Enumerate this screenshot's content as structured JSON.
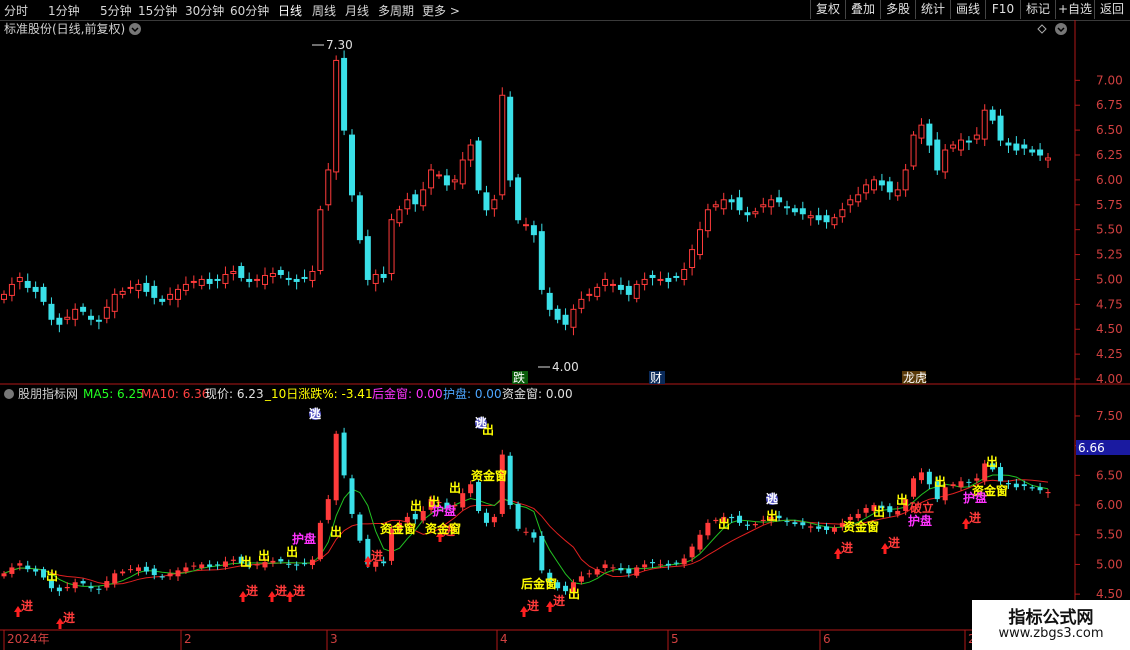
{
  "toolbar": {
    "timeframes": [
      "分时",
      "1分钟",
      "5分钟",
      "15分钟",
      "30分钟",
      "60分钟",
      "日线",
      "周线",
      "月线",
      "多周期",
      "更多 >"
    ],
    "active_timeframe": "日线",
    "right_buttons": [
      "复权",
      "叠加",
      "多股",
      "统计",
      "画线",
      "F10",
      "标记",
      "+自选",
      "返回"
    ]
  },
  "main_panel": {
    "title": "标准股份(日线,前复权)",
    "y_ticks": [
      "7.00",
      "6.75",
      "6.50",
      "6.25",
      "6.00",
      "5.75",
      "5.50",
      "5.25",
      "5.00",
      "4.75",
      "4.50",
      "4.25",
      "4.00"
    ],
    "high_label": "7.30",
    "low_label": "4.00",
    "event_labels": [
      "跌",
      "财",
      "龙虎"
    ]
  },
  "sub_panel": {
    "title": "股朋指标网",
    "ma5": "MA5: 6.25",
    "ma10": "MA10: 6.36",
    "price": "现价: 6.23",
    "chg": "_10日涨跌%: -3.41",
    "hou": "后金窗: 0.00",
    "hu": "护盘: 0.00",
    "zi": "资金窗: 0.00",
    "y_ticks": [
      "7.50",
      "7.00",
      "6.50",
      "6.00",
      "5.50",
      "5.00",
      "4.50"
    ],
    "current_value": "6.66"
  },
  "signals": {
    "out": "出",
    "in": "进",
    "escape": "逃",
    "capital_window": "资金窗",
    "later_window": "后金窗",
    "protect": "护盘",
    "break": "破立"
  },
  "x_axis": {
    "labels": [
      "2024年",
      "2",
      "3",
      "4",
      "5",
      "6",
      "2"
    ]
  },
  "watermark": {
    "line1": "指标公式网",
    "line2": "www.zbgs3.com"
  },
  "colors": {
    "up": "#ff3b3b",
    "down": "#3ae0e8",
    "axis": "#b01818",
    "yellow": "#ffff00",
    "magenta": "#ff33ff",
    "green_line": "#22c022",
    "blue_text": "#4da6ff"
  },
  "chart_data": {
    "type": "candlestick",
    "x_months": [
      "2024年",
      "2",
      "3",
      "4",
      "5",
      "6"
    ],
    "ylim_main": [
      3.95,
      7.35
    ],
    "high": 7.3,
    "low": 4.0,
    "ma5_last": 6.25,
    "ma10_last": 6.36,
    "last_price": 6.23,
    "chg_10d_pct": -3.41
  }
}
